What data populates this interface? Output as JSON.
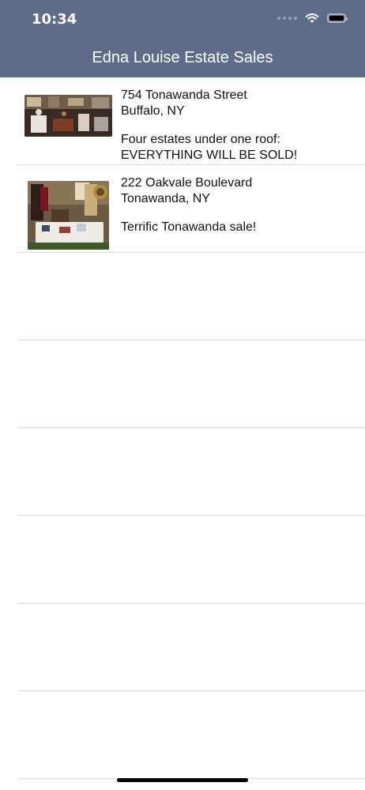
{
  "status_bar": {
    "time": "10:34",
    "icons": [
      "signal-dots-icon",
      "wifi-icon",
      "battery-icon"
    ]
  },
  "nav": {
    "title": "Edna Louise Estate Sales"
  },
  "sales": [
    {
      "street": "754 Tonawanda Street",
      "city": "Buffalo, NY",
      "description_line1": "Four estates under one roof:",
      "description_line2": "EVERYTHING WILL BE SOLD!",
      "thumbnail": "estate-sale-room-photo"
    },
    {
      "street": "222 Oakvale Boulevard",
      "city": "Tonawanda, NY",
      "description_line1": "Terrific Tonawanda sale!",
      "description_line2": "",
      "thumbnail": "estate-sale-items-photo"
    }
  ],
  "colors": {
    "nav_background": "#5d6d89",
    "separator": "#dcdcdc"
  }
}
